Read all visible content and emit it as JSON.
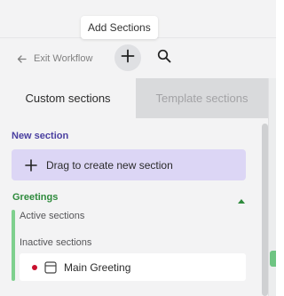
{
  "tooltip": {
    "text": "Add Sections"
  },
  "toolbar": {
    "exit_label": "Exit Workflow",
    "exit_icon": "arrow-left-icon",
    "add_icon": "plus-icon",
    "search_icon": "search-icon"
  },
  "tabs": [
    {
      "label": "Custom sections",
      "active": true
    },
    {
      "label": "Template sections",
      "active": false
    }
  ],
  "new_section": {
    "heading": "New section",
    "drag_label": "Drag to create new section",
    "drag_icon": "plus-icon"
  },
  "group": {
    "title": "Greetings",
    "toggle_icon": "caret-up-icon",
    "active_label": "Active sections",
    "inactive_label": "Inactive sections",
    "items": [
      {
        "name": "Main Greeting",
        "status": "inactive",
        "icon": "section-layout-icon"
      }
    ]
  },
  "colors": {
    "accent_purple": "#4a3fa0",
    "drag_background": "#dcd6f5",
    "greetings_green": "#2e8a3c",
    "group_bar_green": "#7fd08e",
    "status_red": "#c8102e"
  }
}
